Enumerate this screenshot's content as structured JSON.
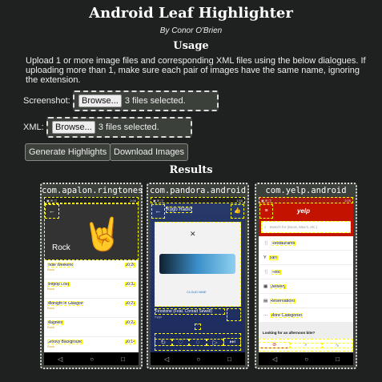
{
  "title": "Android Leaf Highlighter",
  "byline": "By Conor O'Brien",
  "usage_heading": "Usage",
  "usage_text": "Upload 1 or more image files and corresponding XML files using the below dialogues. If uploading more than 1, make sure each pair of images have the same name, ignoring the extension.",
  "screenshot": {
    "label": "Screenshot:",
    "browse": "Browse...",
    "status": "3 files selected."
  },
  "xml": {
    "label": "XML:",
    "browse": "Browse...",
    "status": "3 files selected."
  },
  "buttons": {
    "generate": "Generate Highlights",
    "download": "Download Images"
  },
  "results_heading": "Results",
  "results": [
    {
      "name": "com.apalon.ringtones",
      "status_time": "2:08",
      "header": "Rock",
      "rows": [
        {
          "title": "Indie Weekend",
          "sub": "Rock",
          "dur": "00:26"
        },
        {
          "title": "Britpop Loop",
          "sub": "Rock",
          "dur": "00:32"
        },
        {
          "title": "Midnight In Glasgow",
          "sub": "Rock",
          "dur": "00:21"
        },
        {
          "title": "Magnetic",
          "sub": "Rock",
          "dur": "00:22"
        },
        {
          "title": "Groovy Background",
          "sub": "Rock",
          "dur": "00:14"
        }
      ]
    },
    {
      "name": "com.pandora.android",
      "status_time": "1:55",
      "station": "Kygo Radio",
      "album": "CLOUD NINE",
      "track": "Firestone (Feat. Conrad Sewell)",
      "artist": "Kygo"
    },
    {
      "name": "com.yelp.android",
      "status_time": "2:05",
      "logo": "yelp",
      "search_placeholder": "Search for (tacos, Max's, etc.)",
      "categories": [
        "Restaurants",
        "Bars",
        "Food",
        "Delivery",
        "Reservations",
        "More Categories"
      ],
      "prompt": "Looking for an afternoon bite?"
    }
  ]
}
